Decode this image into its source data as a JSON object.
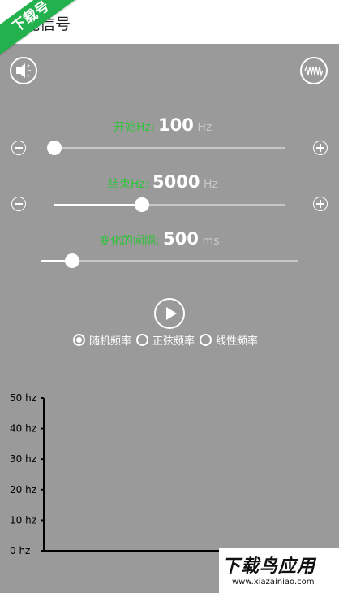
{
  "header": {
    "title": "沌信号",
    "watermark": "下载号"
  },
  "icons": {
    "left": "speaker-icon",
    "right": "waveform-icon"
  },
  "sliders": [
    {
      "label": "开始Hz:",
      "value": "100",
      "unit": "Hz",
      "fraction": 0.0
    },
    {
      "label": "结束Hz:",
      "value": "5000",
      "unit": "Hz",
      "fraction": 0.38
    },
    {
      "label": "变化的间隔:",
      "value": "500",
      "unit": "ms",
      "fraction": 0.12
    }
  ],
  "mode": {
    "options": [
      "随机频率",
      "正弦频率",
      "线性频率"
    ],
    "selected_index": 0
  },
  "chart_data": {
    "type": "line",
    "y_tick_labels": [
      "50 hz",
      "40 hz",
      "30 hz",
      "20 hz",
      "10 hz",
      "0 hz"
    ],
    "ylim": [
      0,
      50
    ],
    "series": []
  },
  "footer_logo": {
    "main": "下载鸟应用",
    "sub": "www.xiazainiao.com"
  }
}
